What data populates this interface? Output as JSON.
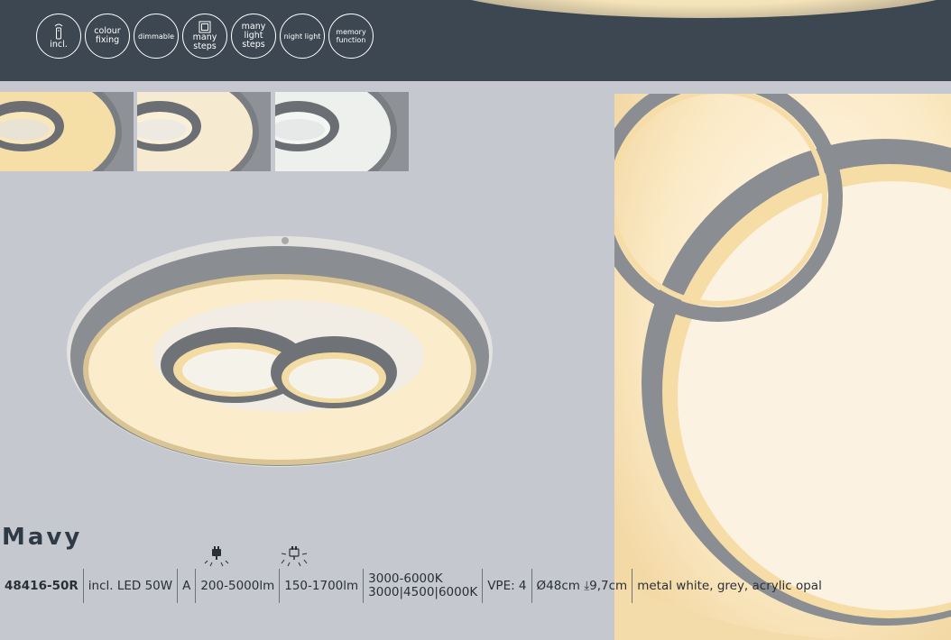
{
  "features": [
    {
      "name": "remote-icon",
      "label": "incl."
    },
    {
      "label_lines": [
        "colour",
        "fixing"
      ]
    },
    {
      "label": "dimmable"
    },
    {
      "name": "steps-icon",
      "label_lines": [
        "many",
        "steps"
      ]
    },
    {
      "label_lines": [
        "many",
        "light",
        "steps"
      ]
    },
    {
      "label": "night light"
    },
    {
      "label_lines": [
        "memory",
        "function"
      ]
    }
  ],
  "product": {
    "name": "Mavy",
    "specs": {
      "article": "48416-50R",
      "light_source": "incl. LED 50W",
      "energy_class": "A",
      "lumen_1": "200-5000lm",
      "lumen_2": "150-1700lm",
      "color_temp_range": "3000-6000K",
      "color_temp_steps": "3000|4500|6000K",
      "vpe": "VPE: 4",
      "dimensions": "Ø48cm ⤓9,7cm",
      "material": "metal white, grey, acrylic opal"
    }
  },
  "colors": {
    "header_bg": "#3c4752",
    "page_bg": "#c5c8ce",
    "ring_grey": "#8a8d91",
    "warm_light": "#fbeccb"
  }
}
